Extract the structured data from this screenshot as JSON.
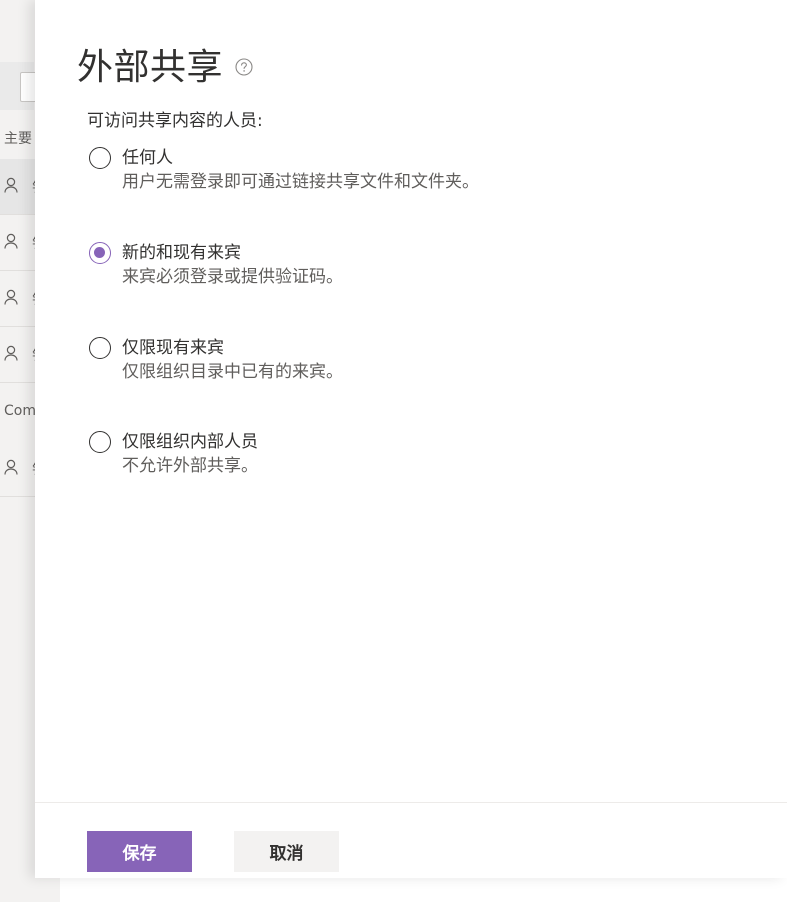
{
  "background": {
    "section_main": "主要",
    "section_com": "Com",
    "row_glyph": "钅"
  },
  "panel": {
    "title": "外部共享",
    "help_icon": "question-circle-icon",
    "section_label": "可访问共享内容的人员:",
    "options": [
      {
        "title": "任何人",
        "description": "用户无需登录即可通过链接共享文件和文件夹。",
        "checked": false
      },
      {
        "title": "新的和现有来宾",
        "description": "来宾必须登录或提供验证码。",
        "checked": true
      },
      {
        "title": "仅限现有来宾",
        "description": "仅限组织目录中已有的来宾。",
        "checked": false
      },
      {
        "title": "仅限组织内部人员",
        "description": "不允许外部共享。",
        "checked": false
      }
    ]
  },
  "footer": {
    "save_label": "保存",
    "cancel_label": "取消"
  },
  "colors": {
    "accent": "#8764b8",
    "text": "#323130",
    "secondary_text": "#605e5c"
  }
}
